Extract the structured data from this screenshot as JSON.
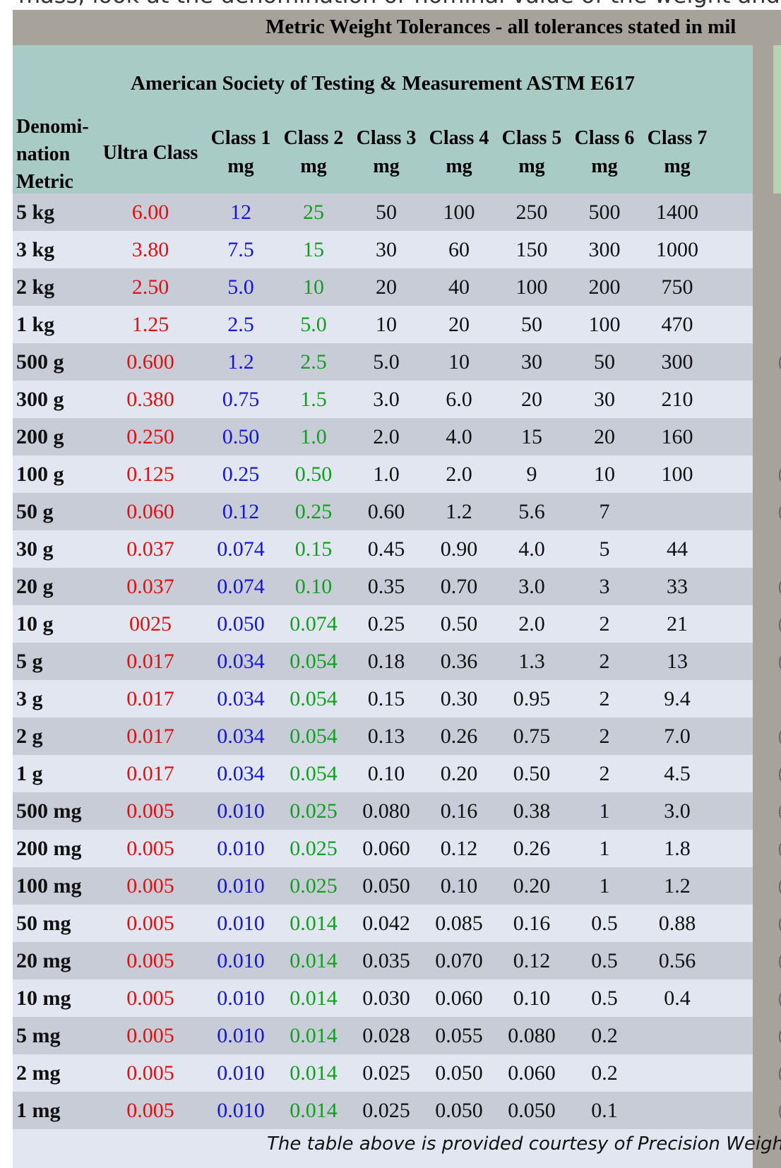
{
  "intro_text": "mass, look at the denomination or nominal value of the weight and c",
  "title": "Metric Weight Tolerances - all tolerances stated in mil",
  "table": {
    "super_header": "American Society of Testing & Measurement ASTM E617",
    "col_denom": [
      "Denomi-",
      "nation",
      "Metric"
    ],
    "col_ultra": "Ultra Class",
    "class_headers": [
      [
        "Class 1",
        "mg"
      ],
      [
        "Class 2",
        "mg"
      ],
      [
        "Class 3",
        "mg"
      ],
      [
        "Class 4",
        "mg"
      ],
      [
        "Class 5",
        "mg"
      ],
      [
        "Class 6",
        "mg"
      ],
      [
        "Class 7",
        "mg"
      ]
    ],
    "rows": [
      {
        "d": "5 kg",
        "v": [
          "6.00",
          "12",
          "25",
          "50",
          "100",
          "250",
          "500",
          "1400"
        ]
      },
      {
        "d": "3 kg",
        "v": [
          "3.80",
          "7.5",
          "15",
          "30",
          "60",
          "150",
          "300",
          "1000"
        ]
      },
      {
        "d": "2 kg",
        "v": [
          "2.50",
          "5.0",
          "10",
          "20",
          "40",
          "100",
          "200",
          "750"
        ]
      },
      {
        "d": "1 kg",
        "v": [
          "1.25",
          "2.5",
          "5.0",
          "10",
          "20",
          "50",
          "100",
          "470"
        ]
      },
      {
        "d": "500 g",
        "v": [
          "0.600",
          "1.2",
          "2.5",
          "5.0",
          "10",
          "30",
          "50",
          "300"
        ]
      },
      {
        "d": "300 g",
        "v": [
          "0.380",
          "0.75",
          "1.5",
          "3.0",
          "6.0",
          "20",
          "30",
          "210"
        ]
      },
      {
        "d": "200 g",
        "v": [
          "0.250",
          "0.50",
          "1.0",
          "2.0",
          "4.0",
          "15",
          "20",
          "160"
        ]
      },
      {
        "d": "100 g",
        "v": [
          "0.125",
          "0.25",
          "0.50",
          "1.0",
          "2.0",
          "9",
          "10",
          "100"
        ]
      },
      {
        "d": "50 g",
        "v": [
          "0.060",
          "0.12",
          "0.25",
          "0.60",
          "1.2",
          "5.6",
          "7",
          ""
        ]
      },
      {
        "d": "30 g",
        "v": [
          "0.037",
          "0.074",
          "0.15",
          "0.45",
          "0.90",
          "4.0",
          "5",
          "44"
        ]
      },
      {
        "d": "20 g",
        "v": [
          "0.037",
          "0.074",
          "0.10",
          "0.35",
          "0.70",
          "3.0",
          "3",
          "33"
        ]
      },
      {
        "d": "10 g",
        "v": [
          "0025",
          "0.050",
          "0.074",
          "0.25",
          "0.50",
          "2.0",
          "2",
          "21"
        ]
      },
      {
        "d": "5 g",
        "v": [
          "0.017",
          "0.034",
          "0.054",
          "0.18",
          "0.36",
          "1.3",
          "2",
          "13"
        ]
      },
      {
        "d": "3 g",
        "v": [
          "0.017",
          "0.034",
          "0.054",
          "0.15",
          "0.30",
          "0.95",
          "2",
          "9.4"
        ]
      },
      {
        "d": "2 g",
        "v": [
          "0.017",
          "0.034",
          "0.054",
          "0.13",
          "0.26",
          "0.75",
          "2",
          "7.0"
        ]
      },
      {
        "d": "1 g",
        "v": [
          "0.017",
          "0.034",
          "0.054",
          "0.10",
          "0.20",
          "0.50",
          "2",
          "4.5"
        ]
      },
      {
        "d": "500 mg",
        "v": [
          "0.005",
          "0.010",
          "0.025",
          "0.080",
          "0.16",
          "0.38",
          "1",
          "3.0"
        ]
      },
      {
        "d": "200 mg",
        "v": [
          "0.005",
          "0.010",
          "0.025",
          "0.060",
          "0.12",
          "0.26",
          "1",
          "1.8"
        ]
      },
      {
        "d": "100 mg",
        "v": [
          "0.005",
          "0.010",
          "0.025",
          "0.050",
          "0.10",
          "0.20",
          "1",
          "1.2"
        ]
      },
      {
        "d": "50 mg",
        "v": [
          "0.005",
          "0.010",
          "0.014",
          "0.042",
          "0.085",
          "0.16",
          "0.5",
          "0.88"
        ]
      },
      {
        "d": "20 mg",
        "v": [
          "0.005",
          "0.010",
          "0.014",
          "0.035",
          "0.070",
          "0.12",
          "0.5",
          "0.56"
        ]
      },
      {
        "d": "10 mg",
        "v": [
          "0.005",
          "0.010",
          "0.014",
          "0.030",
          "0.060",
          "0.10",
          "0.5",
          "0.4"
        ]
      },
      {
        "d": "5 mg",
        "v": [
          "0.005",
          "0.010",
          "0.014",
          "0.028",
          "0.055",
          "0.080",
          "0.2",
          ""
        ]
      },
      {
        "d": "2 mg",
        "v": [
          "0.005",
          "0.010",
          "0.014",
          "0.025",
          "0.050",
          "0.060",
          "0.2",
          ""
        ]
      },
      {
        "d": "1 mg",
        "v": [
          "0.005",
          "0.010",
          "0.014",
          "0.025",
          "0.050",
          "0.050",
          "0.1",
          ""
        ]
      }
    ],
    "edge_marks": [
      "",
      "",
      "",
      "",
      "(",
      "",
      "",
      "(",
      "(",
      "",
      "(",
      "(",
      "(",
      "",
      "(",
      "(",
      "(",
      "(",
      "(",
      "(",
      "(",
      "(",
      "(",
      "(",
      "("
    ]
  },
  "footer": "The table above is provided courtesy of Precision Weighing",
  "colors": {
    "ultra": "#e01010",
    "class1": "#1414e0",
    "class2": "#10a020",
    "header_bg": "#a8cbc6",
    "title_bg": "#a8a39a"
  }
}
